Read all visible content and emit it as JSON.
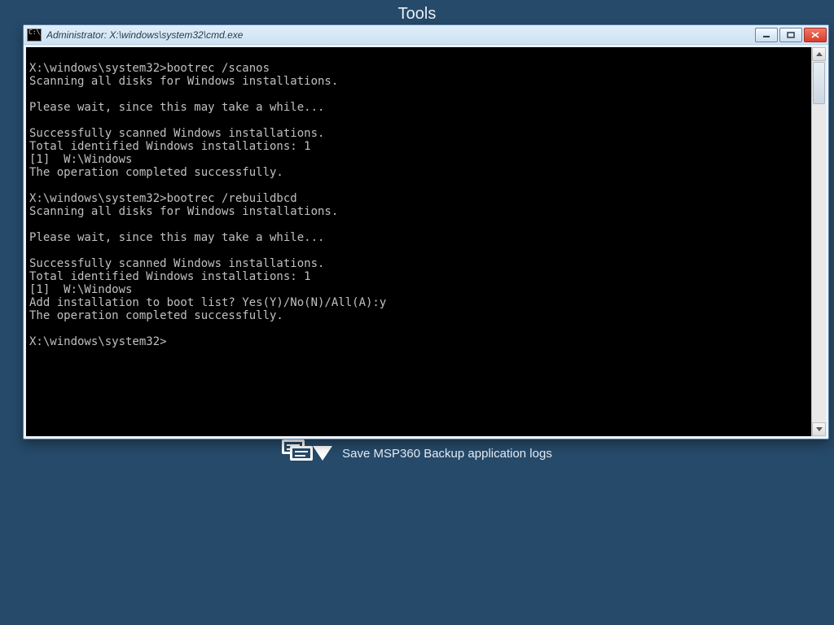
{
  "background": {
    "title": "Tools",
    "logs_row_label": "Save MSP360 Backup application logs"
  },
  "window": {
    "title": "Administrator: X:\\windows\\system32\\cmd.exe"
  },
  "terminal": {
    "lines": [
      "X:\\windows\\system32>bootrec /scanos",
      "Scanning all disks for Windows installations.",
      "",
      "Please wait, since this may take a while...",
      "",
      "Successfully scanned Windows installations.",
      "Total identified Windows installations: 1",
      "[1]  W:\\Windows",
      "The operation completed successfully.",
      "",
      "X:\\windows\\system32>bootrec /rebuildbcd",
      "Scanning all disks for Windows installations.",
      "",
      "Please wait, since this may take a while...",
      "",
      "Successfully scanned Windows installations.",
      "Total identified Windows installations: 1",
      "[1]  W:\\Windows",
      "Add installation to boot list? Yes(Y)/No(N)/All(A):y",
      "The operation completed successfully.",
      "",
      "X:\\windows\\system32>"
    ]
  }
}
